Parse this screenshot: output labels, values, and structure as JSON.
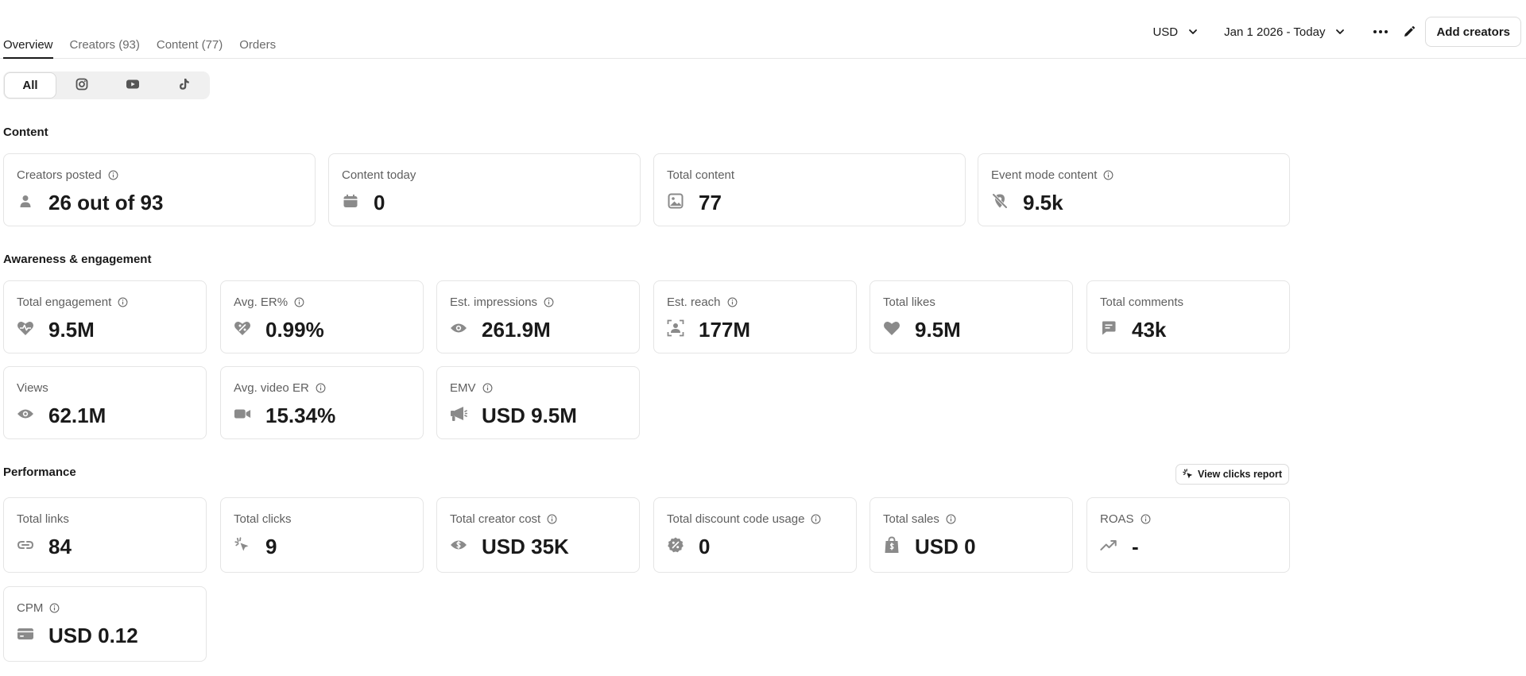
{
  "tabs": [
    {
      "label": "Overview"
    },
    {
      "label": "Creators (93)"
    },
    {
      "label": "Content (77)"
    },
    {
      "label": "Orders"
    }
  ],
  "header": {
    "currency": "USD",
    "date_range": "Jan 1 2026 - Today",
    "add_creators": "Add creators"
  },
  "platform_filter": {
    "all": "All",
    "icons": [
      "instagram-icon",
      "youtube-icon",
      "tiktok-icon"
    ]
  },
  "sections": {
    "content": "Content",
    "awareness": "Awareness & engagement",
    "performance": "Performance"
  },
  "view_clicks_report": "View clicks report",
  "content_cards": [
    {
      "label": "Creators posted",
      "value": "26 out of 93",
      "icon": "person-icon",
      "info": true
    },
    {
      "label": "Content today",
      "value": "0",
      "icon": "calendar-icon",
      "info": false
    },
    {
      "label": "Total content",
      "value": "77",
      "icon": "image-icon",
      "info": false
    },
    {
      "label": "Event mode content",
      "value": "9.5k",
      "icon": "no-location-icon",
      "info": true
    }
  ],
  "awareness_cards": [
    {
      "label": "Total engagement",
      "value": "9.5M",
      "icon": "heart-pulse-icon",
      "info": true
    },
    {
      "label": "Avg. ER%",
      "value": "0.99%",
      "icon": "heart-percent-icon",
      "info": true
    },
    {
      "label": "Est. impressions",
      "value": "261.9M",
      "icon": "eye-icon",
      "info": true
    },
    {
      "label": "Est. reach",
      "value": "177M",
      "icon": "reach-icon",
      "info": true
    },
    {
      "label": "Total likes",
      "value": "9.5M",
      "icon": "heart-icon",
      "info": false
    },
    {
      "label": "Total comments",
      "value": "43k",
      "icon": "comment-icon",
      "info": false
    },
    {
      "label": "Views",
      "value": "62.1M",
      "icon": "eye-icon",
      "info": false
    },
    {
      "label": "Avg. video ER",
      "value": "15.34%",
      "icon": "video-icon",
      "info": true
    },
    {
      "label": "EMV",
      "value": "USD 9.5M",
      "icon": "megaphone-icon",
      "info": true
    }
  ],
  "performance_cards": [
    {
      "label": "Total links",
      "value": "84",
      "icon": "link-icon",
      "info": false
    },
    {
      "label": "Total clicks",
      "value": "9",
      "icon": "click-icon",
      "info": false
    },
    {
      "label": "Total creator cost",
      "value": "USD 35K",
      "icon": "money-icon",
      "info": true
    },
    {
      "label": "Total discount code usage",
      "value": "0",
      "icon": "discount-icon",
      "info": true
    },
    {
      "label": "Total sales",
      "value": "USD 0",
      "icon": "shopping-bag-icon",
      "info": true
    },
    {
      "label": "ROAS",
      "value": "-",
      "icon": "trend-up-icon",
      "info": true
    },
    {
      "label": "CPM",
      "value": "USD 0.12",
      "icon": "card-icon",
      "info": true
    }
  ]
}
